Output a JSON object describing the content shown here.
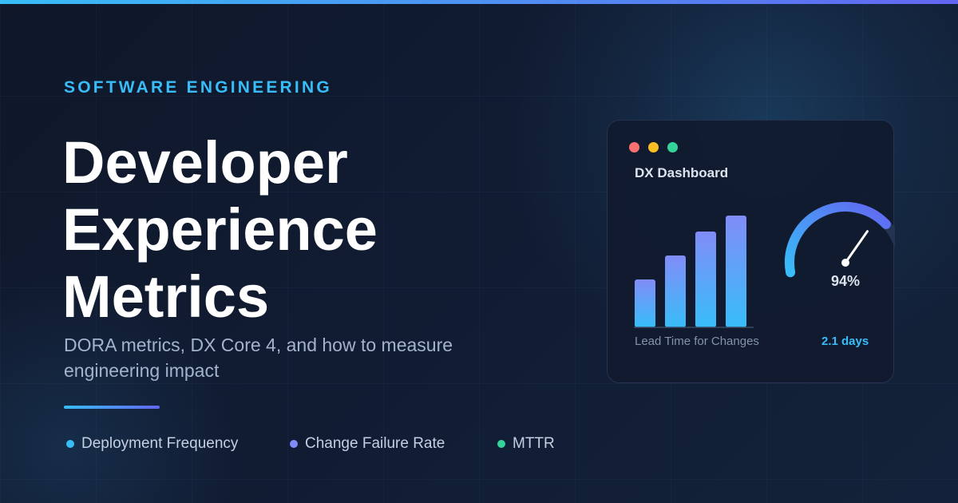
{
  "header": {
    "eyebrow": "SOFTWARE ENGINEERING",
    "title_lines": [
      "Developer",
      "Experience",
      "Metrics"
    ],
    "subtitle": "DORA metrics, DX Core 4, and how to measure engineering impact"
  },
  "metrics": [
    {
      "label": "Deployment Frequency",
      "color": "#38bdf8"
    },
    {
      "label": "Change Failure Rate",
      "color": "#818cf8"
    },
    {
      "label": "MTTR",
      "color": "#34d399"
    }
  ],
  "dashboard": {
    "title": "DX Dashboard",
    "window_dots": [
      "#f87171",
      "#fbbf24",
      "#34d399"
    ],
    "bars": {
      "values": [
        30,
        45,
        60,
        70
      ],
      "max": 70
    },
    "gauge": {
      "value_label": "94%",
      "fraction": 0.94
    },
    "lead_label": "Lead Time for Changes",
    "lead_value": "2.1 days"
  },
  "colors": {
    "accent_cyan": "#38bdf8",
    "accent_indigo": "#6366f1",
    "bar_top": "#818cf8",
    "background": "#0f1729"
  }
}
